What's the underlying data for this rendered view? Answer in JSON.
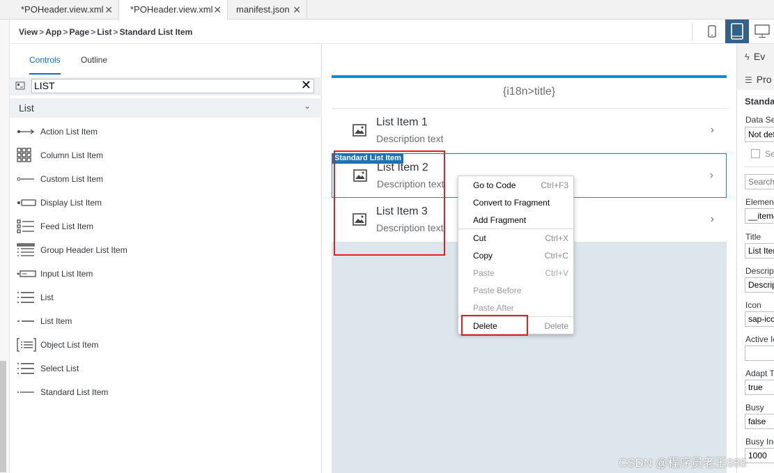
{
  "tabs": [
    {
      "label": "*POHeader.view.xml",
      "close": "✕"
    },
    {
      "label": "*POHeader.view.xml",
      "close": "✕"
    },
    {
      "label": "manifest.json",
      "close": "✕"
    }
  ],
  "breadcrumb": [
    "View",
    "App",
    "Page",
    "List",
    "Standard List Item"
  ],
  "breadcrumb_sep": ">",
  "devices": [
    "phone-icon",
    "tablet-icon",
    "desktop-icon"
  ],
  "palette": {
    "tabs": [
      "Controls",
      "Outline"
    ],
    "search_value": "LIST",
    "search_clear": "✕",
    "group": "List",
    "group_chevron": "⌄",
    "items": [
      {
        "label": "Action List Item",
        "icon": "action-list-item-icon"
      },
      {
        "label": "Column List Item",
        "icon": "column-list-item-icon"
      },
      {
        "label": "Custom List Item",
        "icon": "custom-list-item-icon"
      },
      {
        "label": "Display List Item",
        "icon": "display-list-item-icon"
      },
      {
        "label": "Feed List Item",
        "icon": "feed-list-item-icon"
      },
      {
        "label": "Group Header List Item",
        "icon": "group-header-list-item-icon"
      },
      {
        "label": "Input List Item",
        "icon": "input-list-item-icon"
      },
      {
        "label": "List",
        "icon": "list-icon"
      },
      {
        "label": "List Item",
        "icon": "list-item-icon"
      },
      {
        "label": "Object List Item",
        "icon": "object-list-item-icon"
      },
      {
        "label": "Select List",
        "icon": "select-list-icon"
      },
      {
        "label": "Standard List Item",
        "icon": "standard-list-item-icon"
      }
    ]
  },
  "canvas": {
    "header": "{i18n>title}",
    "selected_label": "Standard List Item",
    "list_items": [
      {
        "title": "List Item 1",
        "description": "Description text",
        "chevron": "›"
      },
      {
        "title": "List Item 2",
        "description": "Description text",
        "chevron": "›"
      },
      {
        "title": "List Item 3",
        "description": "Description text",
        "chevron": "›"
      }
    ]
  },
  "context_menu": {
    "items": [
      {
        "label": "Go to Code",
        "shortcut": "Ctrl+F3",
        "enabled": true
      },
      {
        "label": "Convert to Fragment",
        "shortcut": "",
        "enabled": true
      },
      {
        "label": "Add Fragment",
        "shortcut": "",
        "enabled": true
      },
      {
        "label": "Cut",
        "shortcut": "Ctrl+X",
        "enabled": true
      },
      {
        "label": "Copy",
        "shortcut": "Ctrl+C",
        "enabled": true
      },
      {
        "label": "Paste",
        "shortcut": "Ctrl+V",
        "enabled": false
      },
      {
        "label": "Paste Before",
        "shortcut": "",
        "enabled": false
      },
      {
        "label": "Paste After",
        "shortcut": "",
        "enabled": false
      },
      {
        "label": "Delete",
        "shortcut": "Delete",
        "enabled": true
      }
    ]
  },
  "right_panel": {
    "tabs": [
      {
        "label": "Ev",
        "icon": "lightning-icon"
      },
      {
        "label": "Pro",
        "icon": "properties-icon"
      }
    ],
    "section": "Standa",
    "data_set_label": "Data Se",
    "data_set_value": "Not def",
    "checkbox_label": "Se",
    "search_placeholder": "Search",
    "fields": [
      {
        "label": "Element",
        "value": "__item4"
      },
      {
        "label": "Title",
        "value": "List Iter"
      },
      {
        "label": "Descript",
        "value": "Descrip"
      },
      {
        "label": "Icon",
        "value": "sap-ico"
      },
      {
        "label": "Active Ic",
        "value": ""
      },
      {
        "label": "Adapt Ti",
        "value": "true"
      },
      {
        "label": "Busy",
        "value": "false"
      },
      {
        "label": "Busy Ind",
        "value": "1000"
      }
    ]
  },
  "watermark": "CSDN @程序员老王888",
  "colors": {
    "accent": "#0a6ed1",
    "selection": "#0a8ed9",
    "highlight": "#e0201b",
    "device_selected": "#346187"
  }
}
